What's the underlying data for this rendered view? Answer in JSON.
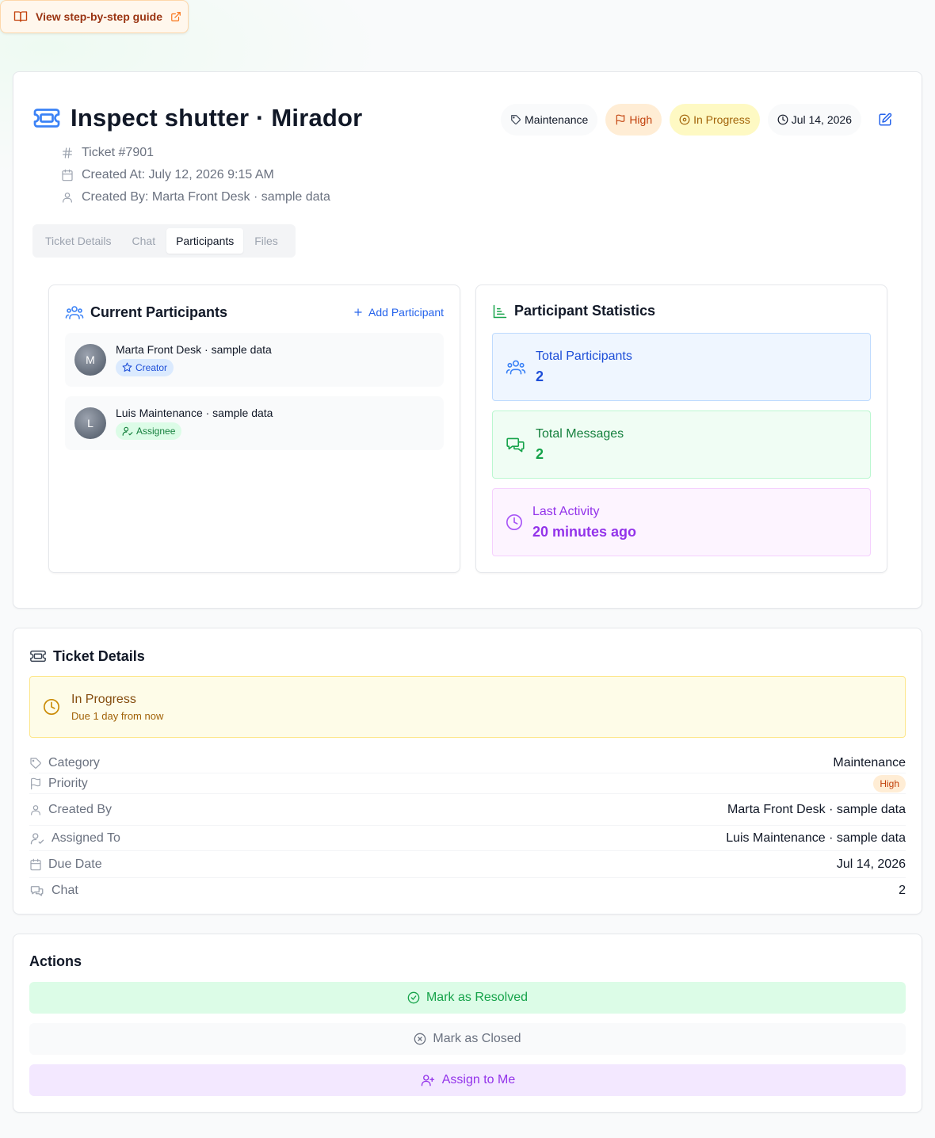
{
  "guide": {
    "label": "View step-by-step guide"
  },
  "ticket": {
    "title": "Inspect shutter · Mirador",
    "number": "Ticket #7901",
    "created_at": "Created At: July 12, 2026 9:15 AM",
    "created_by": "Created By: Marta Front Desk · sample data",
    "badges": {
      "category": "Maintenance",
      "priority": "High",
      "status": "In Progress",
      "due": "Jul 14, 2026"
    }
  },
  "tabs": [
    {
      "label": "Ticket Details",
      "active": false
    },
    {
      "label": "Chat",
      "active": false
    },
    {
      "label": "Participants",
      "active": true
    },
    {
      "label": "Files",
      "active": false
    }
  ],
  "participants": {
    "title": "Current Participants",
    "add_label": "Add Participant",
    "items": [
      {
        "initial": "M",
        "name": "Marta Front Desk · sample data",
        "role": "Creator"
      },
      {
        "initial": "L",
        "name": "Luis Maintenance · sample data",
        "role": "Assignee"
      }
    ]
  },
  "stats": {
    "title": "Participant Statistics",
    "total_participants": {
      "label": "Total Participants",
      "value": "2"
    },
    "total_messages": {
      "label": "Total Messages",
      "value": "2"
    },
    "last_activity": {
      "label": "Last Activity",
      "value": "20 minutes ago"
    }
  },
  "details": {
    "title": "Ticket Details",
    "status_title": "In Progress",
    "status_sub": "Due 1 day from now",
    "rows": {
      "category": {
        "label": "Category",
        "value": "Maintenance"
      },
      "priority": {
        "label": "Priority",
        "value": "High"
      },
      "created_by": {
        "label": "Created By",
        "value": "Marta Front Desk · sample data"
      },
      "assigned_to": {
        "label": "Assigned To",
        "value": "Luis Maintenance · sample data"
      },
      "due_date": {
        "label": "Due Date",
        "value": "Jul 14, 2026"
      },
      "chat": {
        "label": "Chat",
        "value": "2"
      }
    }
  },
  "actions": {
    "title": "Actions",
    "resolve": "Mark as Resolved",
    "close": "Mark as Closed",
    "assign": "Assign to Me"
  },
  "colors": {
    "accent_blue": "#2563eb",
    "success_green": "#16a34a",
    "warning_yellow": "#ca8a04",
    "priority_orange": "#c2410c",
    "purple": "#9333ea"
  }
}
